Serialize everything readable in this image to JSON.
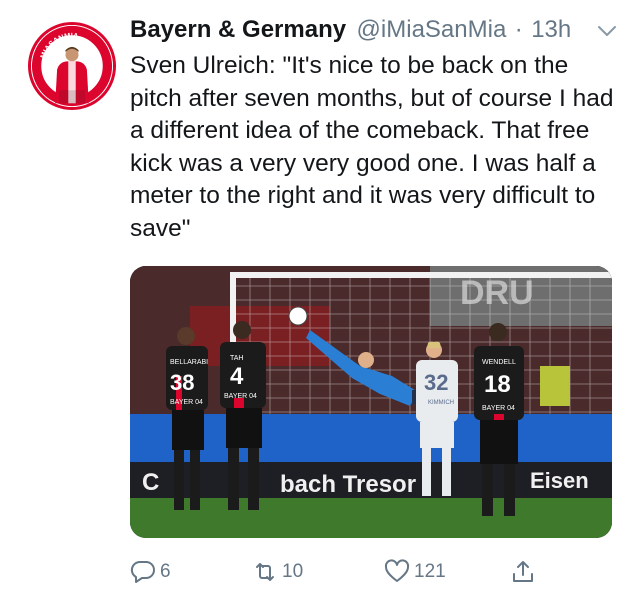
{
  "tweet": {
    "display_name": "Bayern & Germany",
    "handle": "@iMiaSanMia",
    "separator": "·",
    "time": "13h",
    "text": "Sven Ulreich: \"It's nice to be back on the pitch after seven months, but of course I had a different idea of the comeback. That free kick was a very very good one. I was half a meter to the right and it was very difficult to save\""
  },
  "avatar": {
    "ring_text": "MIASANMIA"
  },
  "media": {
    "alt_subject": "goalkeeper diving to save a free kick",
    "ad_text_lower": "bach Tresor",
    "ad_text_right": "Eisen",
    "ad_text_left": "C",
    "ad_text_upper": "DRU",
    "players": [
      {
        "number": "38",
        "name": "BELLARABI",
        "sponsor": "BAYER 04"
      },
      {
        "number": "4",
        "name": "TAH",
        "sponsor": "BAYER 04"
      },
      {
        "number": "32",
        "name": "KIMMICH",
        "sponsor": ""
      },
      {
        "number": "18",
        "name": "WENDELL",
        "sponsor": "BAYER 04"
      }
    ],
    "colors": {
      "leverkusen": "#1b1b1b",
      "bayern_away": "#e8ecef",
      "keeper": "#2a7fd4",
      "pitch": "#3f7a2c",
      "board": "#1f63c8"
    }
  },
  "actions": {
    "reply_count": "6",
    "retweet_count": "10",
    "like_count": "121"
  },
  "icons": {
    "reply": "reply-icon",
    "retweet": "retweet-icon",
    "like": "heart-icon",
    "share": "share-icon",
    "caret": "chevron-down-icon"
  },
  "colors": {
    "text": "#14171a",
    "secondary": "#657786",
    "bayern_red": "#dc052d"
  }
}
